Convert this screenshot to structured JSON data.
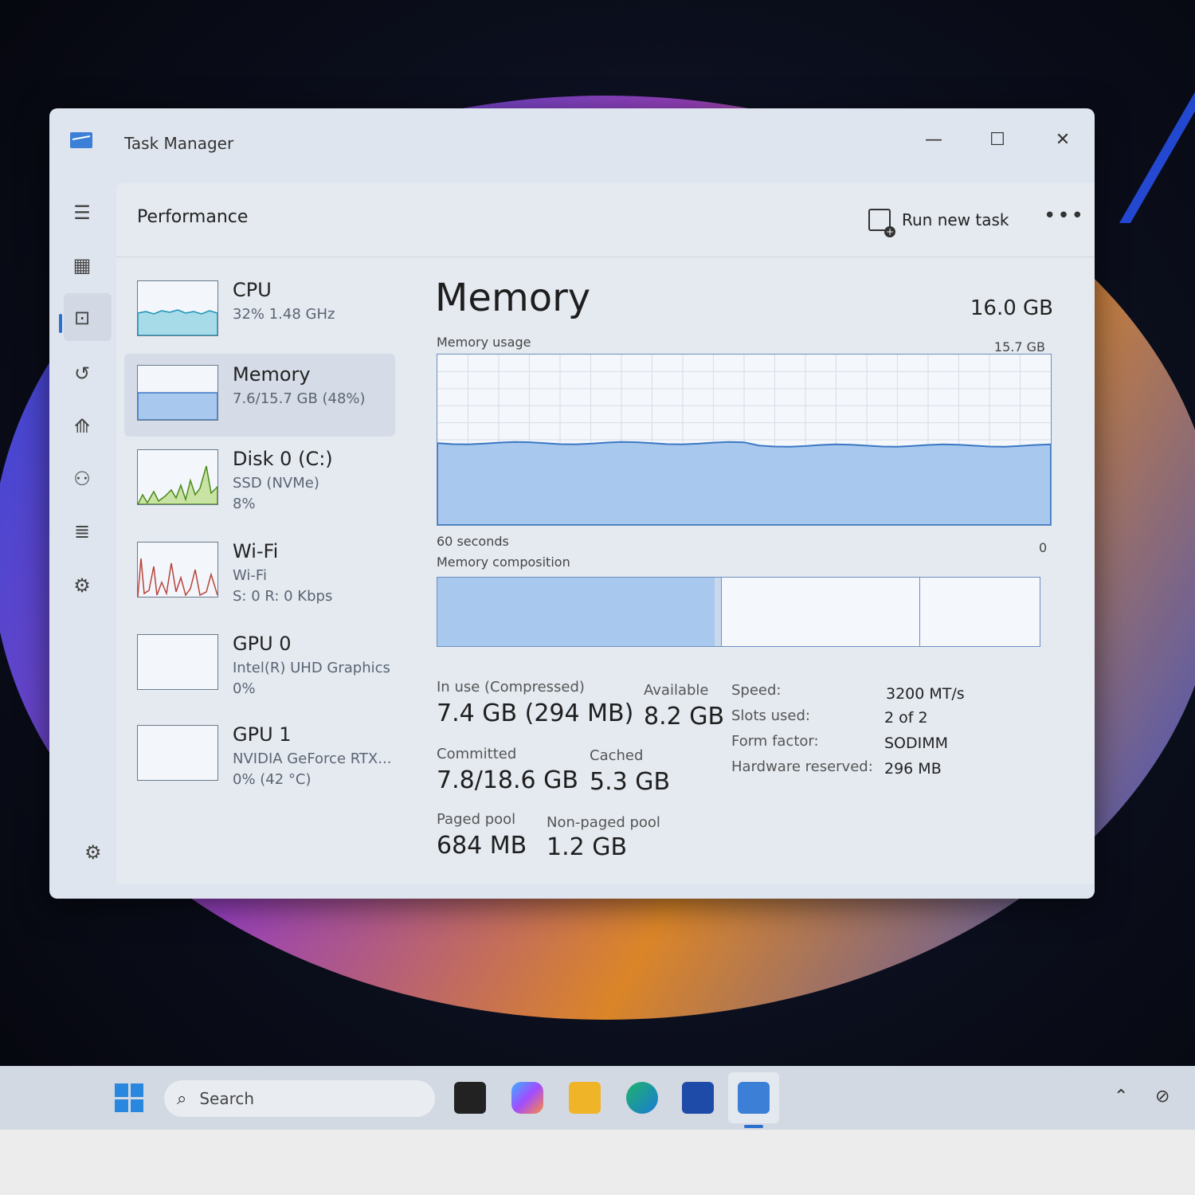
{
  "window": {
    "title": "Task Manager"
  },
  "window_controls": {
    "minimize": "—",
    "maximize": "☐",
    "close": "✕"
  },
  "header": {
    "title": "Performance",
    "run_task": "Run new task",
    "more": "•••"
  },
  "sidebar": [
    {
      "name": "CPU",
      "line2": "32%  1.48 GHz",
      "line3": "",
      "color": "#1a93b8"
    },
    {
      "name": "Memory",
      "line2": "7.6/15.7 GB (48%)",
      "line3": "",
      "color": "#3a78c4"
    },
    {
      "name": "Disk 0 (C:)",
      "line2": "SSD (NVMe)",
      "line3": "8%",
      "color": "#4a8a1c"
    },
    {
      "name": "Wi-Fi",
      "line2": "Wi-Fi",
      "line3": "S: 0 R: 0 Kbps",
      "color": "#b8443c"
    },
    {
      "name": "GPU 0",
      "line2": "Intel(R) UHD Graphics",
      "line3": "0%",
      "color": "#6a7a8c"
    },
    {
      "name": "GPU 1",
      "line2": "NVIDIA GeForce RTX...",
      "line3": "0%  (42 °C)",
      "color": "#6a7a8c"
    }
  ],
  "memory": {
    "title": "Memory",
    "total": "16.0 GB",
    "usage_label": "Memory usage",
    "usage_max": "15.7 GB",
    "time_label": "60 seconds",
    "time_end": "0",
    "usage_fraction": 0.48,
    "composition_label": "Memory composition",
    "composition": {
      "in_use_fraction": 0.46,
      "modified_fraction": 0.01,
      "standby_fraction": 0.33,
      "free_fraction": 0.2
    },
    "in_use_label": "In use (Compressed)",
    "in_use": "7.4 GB (294 MB)",
    "available_label": "Available",
    "available": "8.2 GB",
    "committed_label": "Committed",
    "committed": "7.8/18.6 GB",
    "cached_label": "Cached",
    "cached": "5.3 GB",
    "paged_label": "Paged pool",
    "paged": "684 MB",
    "nonpaged_label": "Non-paged pool",
    "nonpaged": "1.2 GB",
    "specs": [
      {
        "label": "Speed:",
        "value": "3200 MT/s"
      },
      {
        "label": "Slots used:",
        "value": "2 of 2"
      },
      {
        "label": "Form factor:",
        "value": "SODIMM"
      },
      {
        "label": "Hardware reserved:",
        "value": "296 MB"
      }
    ]
  },
  "taskbar": {
    "search_placeholder": "Search"
  },
  "colors": {
    "memory_fill": "#a9c8ee",
    "memory_line": "#3a78c4",
    "accent": "#2b6fd1"
  }
}
